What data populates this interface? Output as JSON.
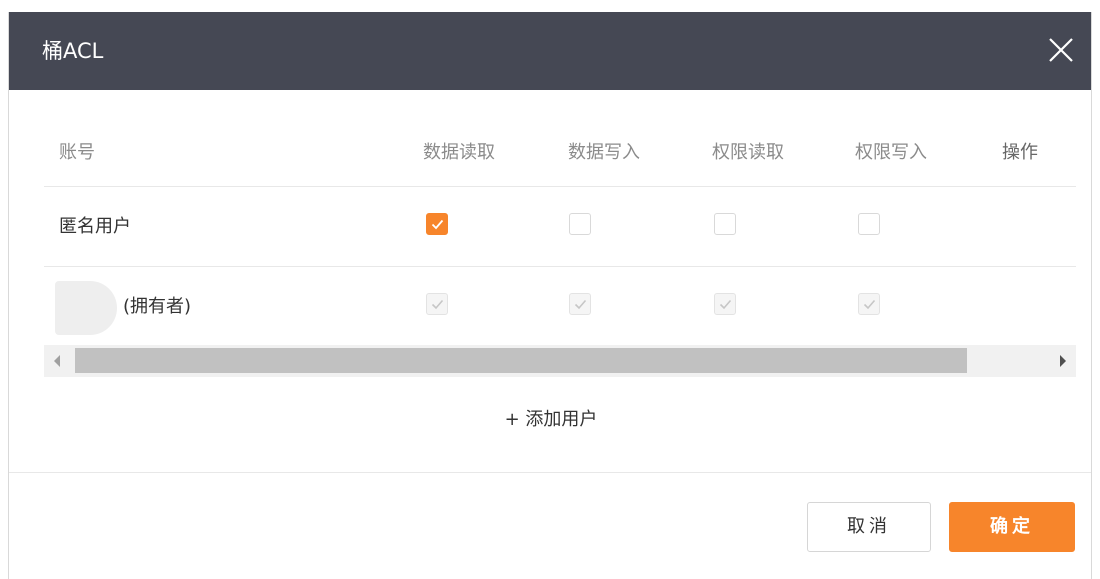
{
  "dialog": {
    "title": "桶ACL",
    "close_icon": "close-icon",
    "header_color": "#454854",
    "accent_color": "#f7852b"
  },
  "table": {
    "headers": [
      "账号",
      "数据读取",
      "数据写入",
      "权限读取",
      "权限写入",
      "操作"
    ],
    "rows": [
      {
        "account": "匿名用户",
        "data_read": "checked",
        "data_write": "unchecked",
        "acl_read": "unchecked",
        "acl_write": "unchecked"
      },
      {
        "account_suffix": "(拥有者)",
        "data_read": "checked-disabled",
        "data_write": "checked-disabled",
        "acl_read": "checked-disabled",
        "acl_write": "checked-disabled"
      }
    ]
  },
  "add_user_label": "+ 添加用户",
  "footer": {
    "cancel_label": "取消",
    "ok_label": "确定"
  }
}
